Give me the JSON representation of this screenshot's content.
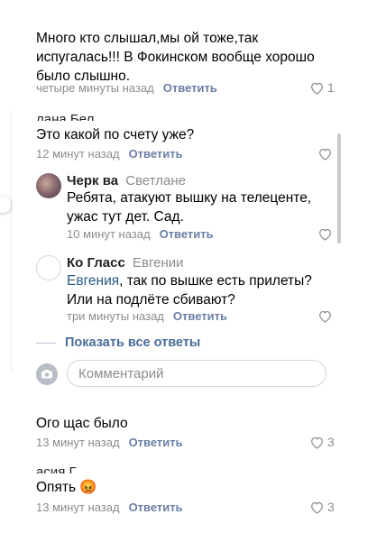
{
  "comments": [
    {
      "text": "Много кто слышал,мы      ой тоже,так испугалась!!! В Фокинском вообще хорошо было слышно.",
      "time": "четыре минуты назад",
      "reply": "Ответить",
      "likes": "1"
    },
    {
      "author": "     лана Бел",
      "text": "Это какой по счету уже?",
      "time": "12 минут назад",
      "reply": "Ответить",
      "likes": ""
    },
    {
      "author": "       Черк      ва",
      "reply_to": "Светлане",
      "text": "Ребята, атакуют вышку на телеценте, ужас тут дет. Сад.",
      "time": "10 минут назад",
      "reply": "Ответить",
      "likes": ""
    },
    {
      "author": "Ко         Гласс",
      "reply_to": "Евгении",
      "mention": "Евгения",
      "text": ", так по вышке есть прилеты? Или на подлёте сбивают?",
      "time": "три минуты назад",
      "reply": "Ответить",
      "likes": ""
    },
    {
      "text": "Ого щас было",
      "time": "13 минут назад",
      "reply": "Ответить",
      "likes": "3"
    },
    {
      "author": "    асия Г",
      "text": "Опять",
      "time": "13 минут назад",
      "reply": "Ответить",
      "likes": "3"
    }
  ],
  "show_all_replies": "Показать все ответы",
  "comment_input": {
    "placeholder": "Комментарий"
  },
  "emoji_angry": "😡"
}
